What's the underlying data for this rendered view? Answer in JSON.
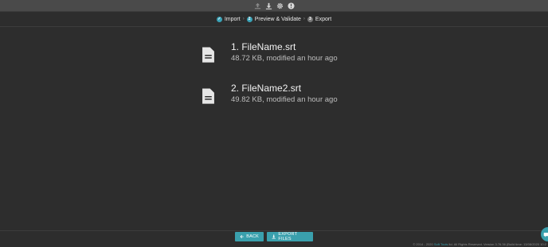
{
  "toolbar": {
    "icons": [
      "upload-icon",
      "download-icon",
      "gear-icon",
      "info-icon"
    ]
  },
  "steps": [
    {
      "label": "Import",
      "badge": "✓",
      "state": "done"
    },
    {
      "label": "Preview & Validate",
      "badge": "2",
      "state": "active"
    },
    {
      "label": "Export",
      "badge": "3",
      "state": "todo"
    }
  ],
  "step_separator": "›",
  "files": [
    {
      "title": "1. FileName.srt",
      "meta": "48.72 KB, modified an hour ago"
    },
    {
      "title": "2. FileName2.srt",
      "meta": "49.82 KB, modified an hour ago"
    }
  ],
  "buttons": {
    "back": "BACK",
    "export": "EXPORT FILES"
  },
  "copyright": {
    "prefix": "© 2014 - 2020 ",
    "link": "Soft Tools",
    "suffix": " ltd. All Rights Reserved. Version 3.76.36 (Build time: 13/08/2020 10:2"
  },
  "colors": {
    "accent": "#3aa0ad",
    "background": "#2d2d2d",
    "topbar": "#4a4a4a"
  }
}
